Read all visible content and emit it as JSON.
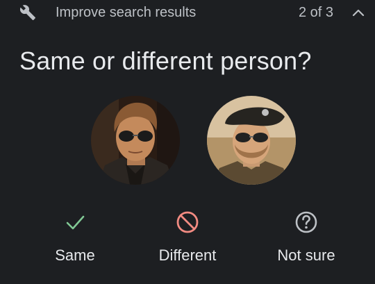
{
  "header": {
    "title": "Improve search results",
    "counter": "2 of 3",
    "icon": "wrench-icon",
    "collapse_icon": "chevron-up-icon"
  },
  "question": "Same or different person?",
  "faces": [
    {
      "name": "face-left",
      "icon": "face-photo"
    },
    {
      "name": "face-right",
      "icon": "face-photo"
    }
  ],
  "options": [
    {
      "label": "Same",
      "icon": "check-icon",
      "color": "#81c995"
    },
    {
      "label": "Different",
      "icon": "prohibited-icon",
      "color": "#f28b82"
    },
    {
      "label": "Not sure",
      "icon": "help-circle-icon",
      "color": "#bdc1c6"
    }
  ],
  "colors": {
    "background": "#1d1f22",
    "text_primary": "#e8eaed",
    "text_secondary": "#bdc1c6"
  }
}
